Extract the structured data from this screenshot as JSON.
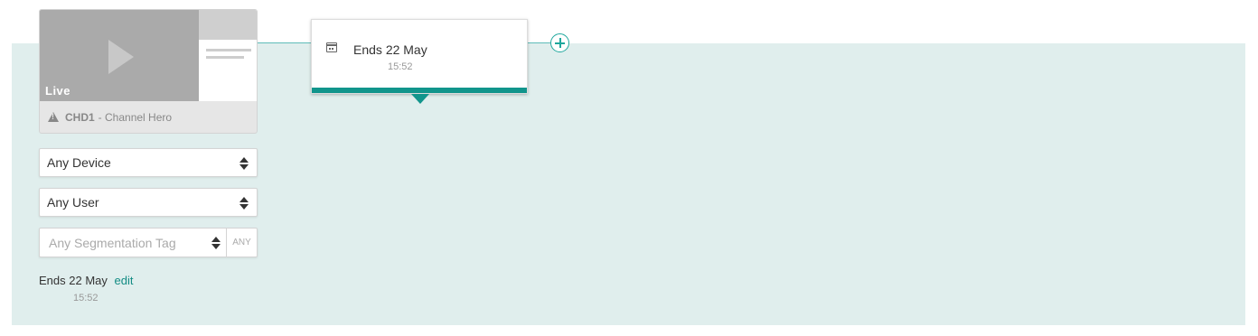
{
  "channel": {
    "live_label": "Live",
    "code": "CHD1",
    "name_suffix": "- Channel Hero"
  },
  "filters": {
    "device": "Any Device",
    "user": "Any User",
    "segmentation_placeholder": "Any Segmentation Tag",
    "segmentation_mode": "ANY"
  },
  "schedule": {
    "ends_label": "Ends",
    "date": "22 May",
    "time": "15:52",
    "edit_label": "edit"
  },
  "popover": {
    "ends_label": "Ends",
    "date": "22 May",
    "time": "15:52"
  },
  "colors": {
    "accent": "#11958c",
    "band_bg": "#e0eeed"
  }
}
